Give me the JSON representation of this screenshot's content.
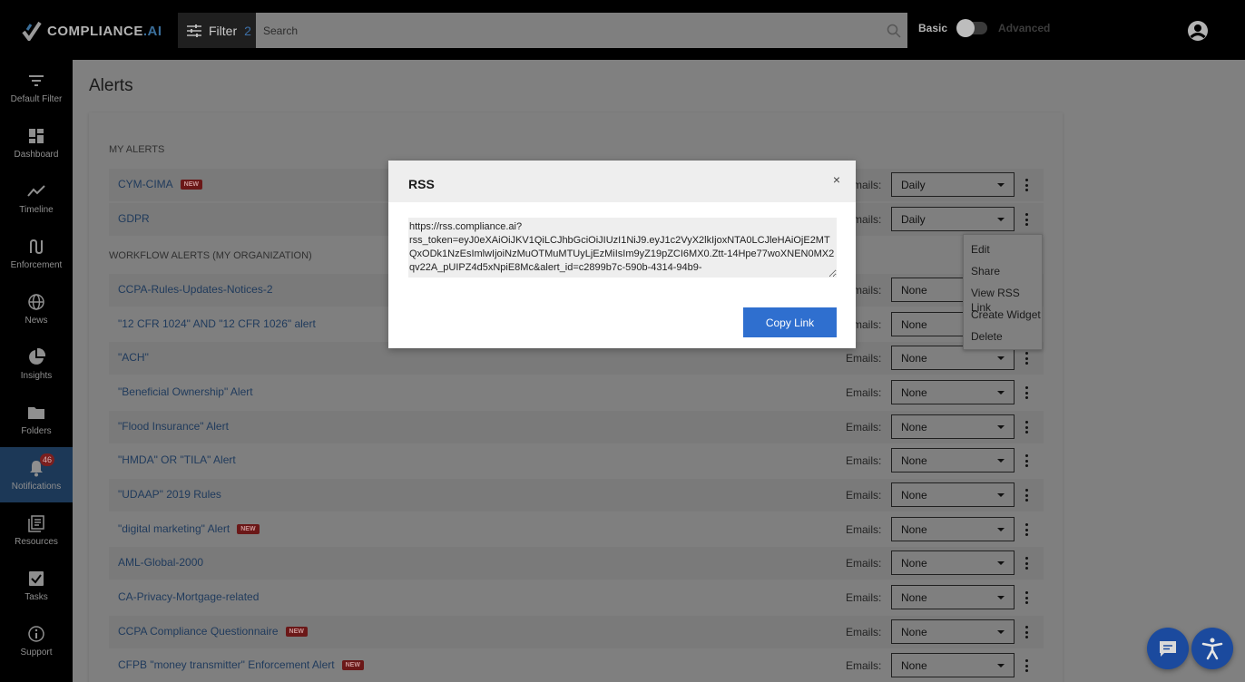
{
  "app": {
    "logo_text": "COMPLIANCE",
    "logo_suffix": ".AI"
  },
  "header": {
    "filter_label": "Filter",
    "filter_count": "2",
    "search_placeholder": "Search",
    "mode_basic": "Basic",
    "mode_advanced": "Advanced"
  },
  "sidebar": {
    "items": [
      {
        "label": "Default Filter",
        "icon": "filter-icon"
      },
      {
        "label": "Dashboard",
        "icon": "dashboard-icon"
      },
      {
        "label": "Timeline",
        "icon": "timeline-icon"
      },
      {
        "label": "Enforcement",
        "icon": "enforcement-icon"
      },
      {
        "label": "News",
        "icon": "globe-icon"
      },
      {
        "label": "Insights",
        "icon": "pie-chart-icon"
      },
      {
        "label": "Folders",
        "icon": "folder-icon"
      },
      {
        "label": "Notifications",
        "icon": "bell-icon",
        "badge": "46",
        "active": true
      },
      {
        "label": "Resources",
        "icon": "resources-icon"
      },
      {
        "label": "Tasks",
        "icon": "checkbox-icon"
      },
      {
        "label": "Support",
        "icon": "info-icon"
      }
    ]
  },
  "page": {
    "title": "Alerts",
    "my_alerts_label": "MY ALERTS",
    "workflow_label": "WORKFLOW ALERTS (MY ORGANIZATION)",
    "emails_label": "Emails:",
    "new_tag": "NEW"
  },
  "my_alerts": [
    {
      "name": "CYM-CIMA",
      "is_new": true,
      "emails": "Daily"
    },
    {
      "name": "GDPR",
      "is_new": false,
      "emails": "Daily"
    }
  ],
  "workflow_alerts": [
    {
      "name": "CCPA-Rules-Updates-Notices-2",
      "is_new": false,
      "emails": "None"
    },
    {
      "name": "\"12 CFR 1024\" AND \"12 CFR 1026\" alert",
      "is_new": false,
      "emails": "None"
    },
    {
      "name": "\"ACH\"",
      "is_new": false,
      "emails": "None"
    },
    {
      "name": "\"Beneficial Ownership\" Alert",
      "is_new": false,
      "emails": "None"
    },
    {
      "name": "\"Flood Insurance\" Alert",
      "is_new": false,
      "emails": "None"
    },
    {
      "name": "\"HMDA\" OR \"TILA\" Alert",
      "is_new": false,
      "emails": "None"
    },
    {
      "name": "\"UDAAP\" 2019 Rules",
      "is_new": false,
      "emails": "None"
    },
    {
      "name": "\"digital marketing\" Alert",
      "is_new": true,
      "emails": "None"
    },
    {
      "name": "AML-Global-2000",
      "is_new": false,
      "emails": "None"
    },
    {
      "name": "CA-Privacy-Mortgage-related",
      "is_new": false,
      "emails": "None"
    },
    {
      "name": "CCPA Compliance Questionnaire",
      "is_new": true,
      "emails": "None"
    },
    {
      "name": "CFPB \"money transmitter\" Enforcement Alert",
      "is_new": true,
      "emails": "None"
    }
  ],
  "context_menu": {
    "items": [
      "Edit",
      "Share",
      "View RSS Link",
      "Create Widget",
      "Delete"
    ]
  },
  "rss_modal": {
    "title": "RSS",
    "close": "×",
    "link": "https://rss.compliance.ai?\nrss_token=eyJ0eXAiOiJKV1QiLCJhbGciOiJIUzI1NiJ9.eyJ1c2VyX2lkIjoxNTA0LCJleHAiOjE2MTQxODk1NzEsImlwIjoiNzMuOTMuMTUyLjEzMiIsIm9yZ19pZCI6MX0.Ztt-14Hpe77woXNEN0MX2qv22A_pUIPZ4d5xNpiE8Mc&alert_id=c2899b7c-590b-4314-94b9-",
    "copy_label": "Copy Link"
  }
}
